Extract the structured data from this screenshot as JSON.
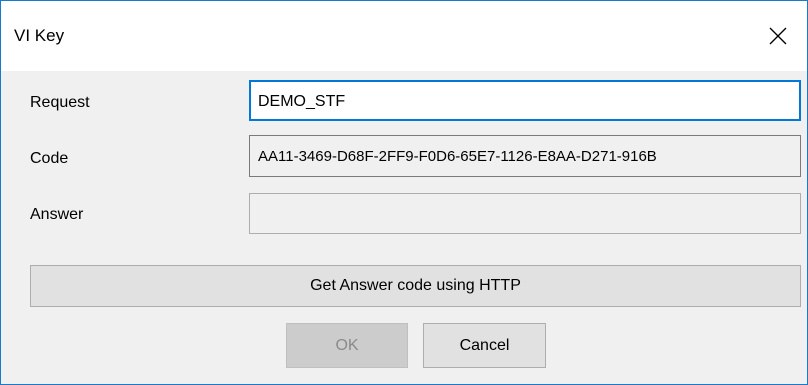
{
  "window": {
    "title": "VI Key",
    "close_icon": "close-icon"
  },
  "form": {
    "request_label": "Request",
    "request_value": "DEMO_STF",
    "code_label": "Code",
    "code_value": "AA11-3469-D68F-2FF9-F0D6-65E7-1126-E8AA-D271-916B",
    "answer_label": "Answer",
    "answer_value": ""
  },
  "buttons": {
    "http_label": "Get Answer code using HTTP",
    "ok_label": "OK",
    "ok_enabled": false,
    "cancel_label": "Cancel"
  },
  "colors": {
    "window_border": "#1979ca",
    "focus_border": "#0078d7",
    "dialog_background": "#f0f0f0"
  }
}
